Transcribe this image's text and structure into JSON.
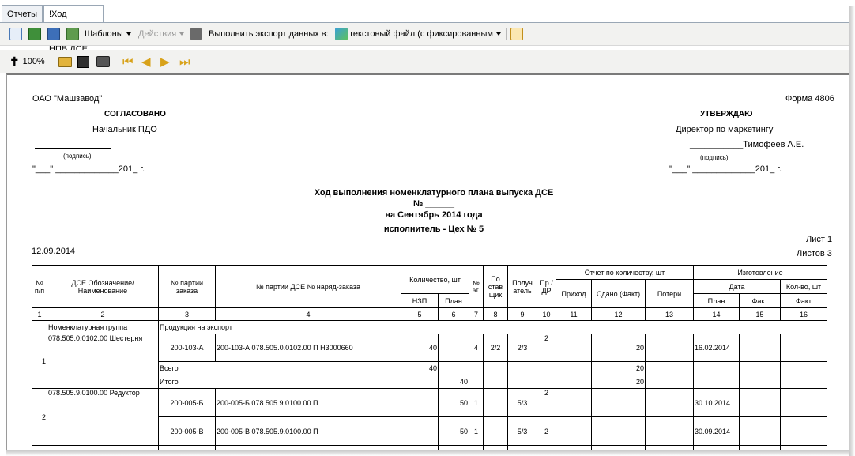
{
  "tabs": [
    {
      "label": "Отчеты"
    },
    {
      "label": "!Ход выполнения НПВ ДСЕ"
    }
  ],
  "toolbar": {
    "templates_label": "Шаблоны",
    "actions_label": "Действия",
    "export_label": "Выполнить экспорт данных в:",
    "export_format": "текстовый файл (с фиксированным"
  },
  "viewer_toolbar": {
    "zoom": "100%"
  },
  "report": {
    "company": "ОАО \"Машзавод\"",
    "form": "Форма 4806",
    "approved_left": "СОГЛАСОВАНО",
    "approver_left_title": "Начальник ПДО",
    "signature_caption_left": "(подпись)",
    "date_line_left": "\"___\" _____________201_ г.",
    "approved_right": "УТВЕРЖДАЮ",
    "approver_right_title": "Директор по маркетингу",
    "approver_right_name": "___________Тимофеев А.Е.",
    "signature_caption_right": "(подпись)",
    "date_line_right": "\"___\" _____________201_ г.",
    "title_line1": "Ход выполнения номенклатурного плана выпуска ДСЕ",
    "title_line2": "№ ______",
    "title_line3": "на Сентябрь 2014 года",
    "title_line4": "исполнитель - Цех № 5",
    "sheet": "Лист 1",
    "sheets": "Листов 3",
    "date": "12.09.2014"
  },
  "table": {
    "headers": {
      "num": "№ п/п",
      "dse": "ДСЕ Обозначение/ Наименование",
      "order_batch": "№ партии заказа",
      "batch_nar": "№ партии ДСЕ № наряд-заказа",
      "qty": "Количество, шт",
      "nzp": "НЗП",
      "plan": "План",
      "stage": "№ эт.",
      "supplier": "По став щик",
      "receiver": "Получ атель",
      "pr_dr": "Пр./ ДР",
      "report_qty": "Отчет по количеству, шт",
      "income": "Приход",
      "delivered": "Сдано (Факт)",
      "losses": "Потери",
      "production": "Изготовление",
      "date": "Дата",
      "qty2": "Кол-во, шт",
      "plan2": "План",
      "fact": "Факт",
      "fact2": "Факт"
    },
    "column_numbers": [
      "1",
      "2",
      "3",
      "4",
      "5",
      "6",
      "7",
      "8",
      "9",
      "10",
      "11",
      "12",
      "13",
      "14",
      "15",
      "16"
    ],
    "group_label": "Номенклатурная группа",
    "group_value": "Продукция на экспорт",
    "rows": [
      {
        "n": "1",
        "dse": "078.505.0.0102.00 Шестерня",
        "order": "200-103-А",
        "batch": "200-103-А 078.505.0.0102.00 П Н3000660",
        "nzp": "40",
        "plan": "",
        "stage": "4",
        "supplier": "2/2",
        "receiver": "2/3",
        "pr": "2",
        "delivered": "20",
        "date_plan": "16.02.2014"
      },
      {
        "n": "2",
        "dse": "078.505.9.0100.00 Редуктор",
        "order": "200-005-Б",
        "batch": "200-005-Б 078.505.9.0100.00 П",
        "nzp": "",
        "plan": "50",
        "stage": "1",
        "supplier": "",
        "receiver": "5/3",
        "pr": "2",
        "delivered": "",
        "date_plan": "30.10.2014"
      },
      {
        "n": "",
        "dse": "",
        "order": "200-005-В",
        "batch": "200-005-В 078.505.9.0100.00 П",
        "nzp": "",
        "plan": "50",
        "stage": "1",
        "supplier": "",
        "receiver": "5/3",
        "pr": "2",
        "delivered": "",
        "date_plan": "30.09.2014"
      }
    ],
    "total1": {
      "label": "Всего",
      "nzp": "40",
      "delivered": "20"
    },
    "total2": {
      "label": "Итого",
      "plan": "40",
      "delivered": "20"
    }
  }
}
